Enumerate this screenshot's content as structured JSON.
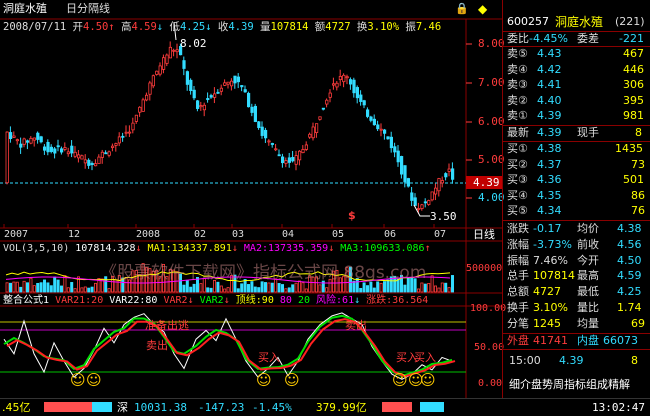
{
  "colors": {
    "up": "#ff3c3c",
    "down": "#32dcff",
    "white": "#ffffff",
    "yellow": "#ffff00",
    "green": "#00ff00",
    "magenta": "#ff00ff",
    "grid": "#8a0000",
    "label": "#c0c0c0",
    "accent": "#ffcc00"
  },
  "header": {
    "title": "洞庭水殖",
    "period": "日分隔线",
    "date": "2008/07/11",
    "open_label": "开",
    "open": "4.50",
    "high_label": "高",
    "high": "4.59",
    "low_label": "低",
    "low": "4.25",
    "close_label": "收",
    "close": "4.39",
    "vol_label": "量",
    "vol": "107814",
    "amt_label": "额",
    "amt": "4727",
    "turn_label": "换",
    "turn": "3.10%",
    "amp_label": "振",
    "amp": "7.46"
  },
  "price_axis": [
    "8.00",
    "7.00",
    "6.00",
    "5.00",
    "4.00"
  ],
  "current_price_tag": "4.39",
  "annotations": {
    "high_mark": "8.02",
    "low_mark": "3.50",
    "dollar": "$"
  },
  "date_axis": [
    "2007",
    "12",
    "2008",
    "02",
    "03",
    "04",
    "05",
    "06",
    "07"
  ],
  "period_button": "日线",
  "vol_panel": {
    "title": "VOL(3,5,10)",
    "vol": "107814.328",
    "ma1": "MA1:134337.891",
    "ma2": "MA2:137335.359",
    "ma3": "MA3:109633.086",
    "axis": "500000",
    "watermark": "《股票软件下载网》指标公式网  88gs.com"
  },
  "ind_panel": {
    "title": "整合公式1",
    "var21": "VAR21:20",
    "var22": "VAR22:80",
    "var2": "VAR2",
    "var3": "VAR2",
    "top": "顶线:90",
    "p80": "80",
    "p20": "20",
    "risk": "风险:61",
    "up": "涨跌:36.564",
    "axis": [
      "100.00",
      "50.00",
      "0.00"
    ],
    "labels": {
      "sell1": "卖出",
      "sell2": "卖出",
      "ready": "准备出逃",
      "buy1": "买入",
      "buy2": "买入",
      "buy3": "买入"
    },
    "smiley": "☺"
  },
  "quote": {
    "code": "600257",
    "name": "洞庭水殖",
    "count": "(221)",
    "weibi_label": "委比",
    "weibi": "-4.45%",
    "weicha_label": "委差",
    "weicha": "-221",
    "sells": [
      {
        "label": "卖⑤",
        "price": "4.43",
        "vol": "467"
      },
      {
        "label": "卖④",
        "price": "4.42",
        "vol": "446"
      },
      {
        "label": "卖③",
        "price": "4.41",
        "vol": "306"
      },
      {
        "label": "卖②",
        "price": "4.40",
        "vol": "395"
      },
      {
        "label": "卖①",
        "price": "4.39",
        "vol": "981"
      }
    ],
    "last_label": "最新",
    "last": "4.39",
    "hand_label": "现手",
    "hand": "8",
    "buys": [
      {
        "label": "买①",
        "price": "4.38",
        "vol": "1435"
      },
      {
        "label": "买②",
        "price": "4.37",
        "vol": "73"
      },
      {
        "label": "买③",
        "price": "4.36",
        "vol": "501"
      },
      {
        "label": "买④",
        "price": "4.35",
        "vol": "86"
      },
      {
        "label": "买⑤",
        "price": "4.34",
        "vol": "76"
      }
    ],
    "stats": [
      {
        "l1": "涨跌",
        "v1": "-0.17",
        "l2": "均价",
        "v2": "4.38"
      },
      {
        "l1": "涨幅",
        "v1": "-3.73%",
        "l2": "前收",
        "v2": "4.56"
      },
      {
        "l1": "振幅",
        "v1": "7.46%",
        "l2": "今开",
        "v2": "4.50"
      },
      {
        "l1": "总手",
        "v1": "107814",
        "l2": "最高",
        "v2": "4.59"
      },
      {
        "l1": "总额",
        "v1": "4727",
        "l2": "最低",
        "v2": "4.25"
      },
      {
        "l1": "换手",
        "v1": "3.10%",
        "l2": "量比",
        "v2": "1.74"
      },
      {
        "l1": "分笔",
        "v1": "1245",
        "l2": "均量",
        "v2": "69"
      }
    ],
    "outer_label": "外盘",
    "outer": "41741",
    "inner_label": "内盘",
    "inner": "66073",
    "tick_time": "15:00",
    "tick_price": "4.39",
    "tick_vol": "8",
    "footer": "细介盘势周指标组成精解"
  },
  "statusbar": {
    "left": ".45亿",
    "index_name": "深",
    "index": "10031.38",
    "chg": "-147.23",
    "pct": "-1.45%",
    "amt": "379.99亿",
    "time": "13:02:47"
  }
}
